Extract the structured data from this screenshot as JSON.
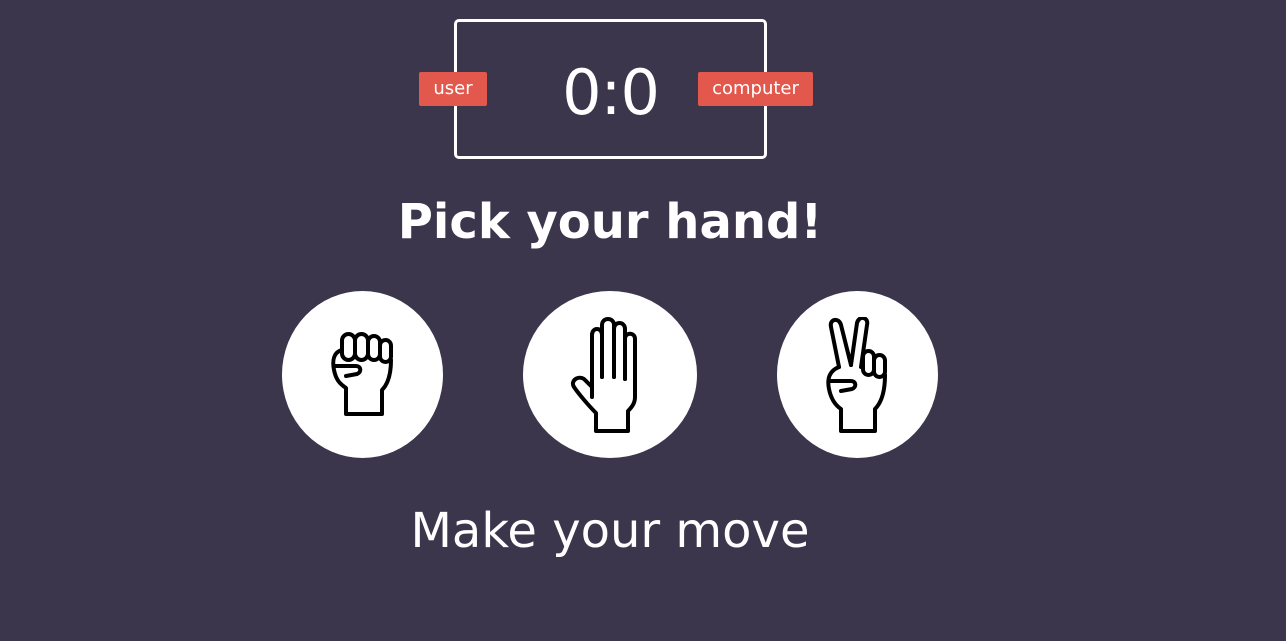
{
  "scoreboard": {
    "score": "0:0",
    "user_label": "user",
    "computer_label": "computer"
  },
  "title": "Pick your hand!",
  "choices": [
    {
      "icon": "rock-hand-icon"
    },
    {
      "icon": "paper-hand-icon"
    },
    {
      "icon": "scissors-hand-icon"
    }
  ],
  "message": "Make your move",
  "colors": {
    "background": "#3b364c",
    "badge": "#e2584d",
    "text": "#ffffff",
    "choice_bg": "#ffffff"
  }
}
